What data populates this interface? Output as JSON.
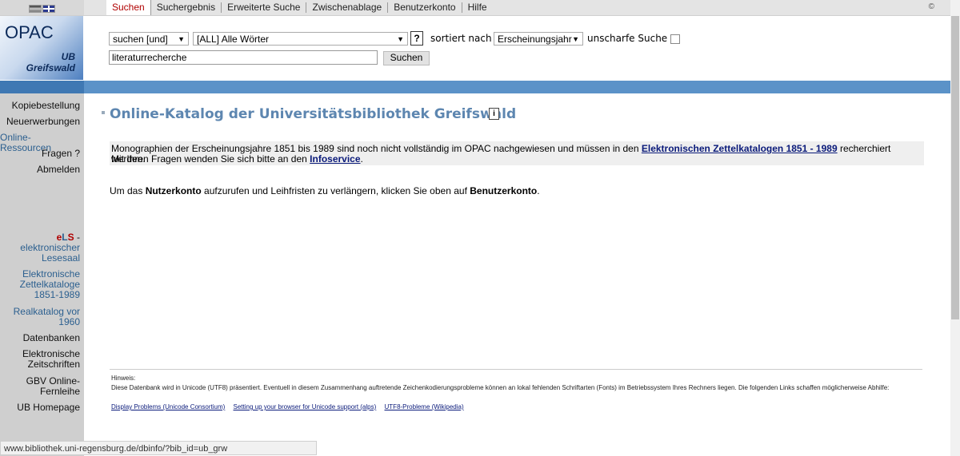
{
  "tabs": [
    {
      "label": "Suchen",
      "active": true
    },
    {
      "label": "Suchergebnis"
    },
    {
      "label": "Erweiterte Suche"
    },
    {
      "label": "Zwischenablage"
    },
    {
      "label": "Benutzerkonto"
    },
    {
      "label": "Hilfe"
    }
  ],
  "topbar": {
    "copyright_symbol": "©"
  },
  "logo": {
    "title": "OPAC",
    "line1": "UB",
    "line2": "Greifswald"
  },
  "search": {
    "mode_value": "suchen [und]",
    "field_value": "[ALL] Alle Wörter",
    "help_label": "?",
    "sort_label": "sortiert nach",
    "sort_value": "Erscheinungsjahr",
    "fuzzy_label": "unscharfe Suche",
    "query": "literaturrecherche",
    "submit_label": "Suchen"
  },
  "sidebar": {
    "items": [
      {
        "label": "Kopiebestellung"
      },
      {
        "label": "Neuerwerbungen"
      },
      {
        "label": "Online-Ressourcen"
      },
      {
        "label": "Fragen ?"
      },
      {
        "label": "Abmelden"
      }
    ],
    "els_e": "e",
    "els_l": "L",
    "els_s": "S",
    "els_dash": " -",
    "els_line2": "elektronischer",
    "els_line3": "Lesesaal",
    "zk_line1": "Elektronische",
    "zk_line2": "Zettelkataloge",
    "zk_line3": "1851-1989",
    "rk_line1": "Realkatalog vor",
    "rk_line2": "1960",
    "db": "Datenbanken",
    "ez_line1": "Elektronische",
    "ez_line2": "Zeitschriften",
    "gbv_line1": "GBV Online-",
    "gbv_line2": "Fernleihe",
    "homepage": "UB Homepage"
  },
  "main": {
    "title": "Online-Katalog der Universitätsbibliothek Greifswald",
    "info_icon": "i",
    "notice_l1_pre": "Monographien der Erscheinungsjahre 1851 bis 1989 sind noch nicht vollständig im OPAC nachgewiesen und müssen in den ",
    "notice_l1_link": "Elektronischen Zettelkatalogen 1851 - 1989",
    "notice_l1_post": " recherchiert werden.",
    "notice_l2_pre": "Mit Ihren Fragen wenden Sie sich bitte an den ",
    "notice_l2_link": "Infoservice",
    "notice_l2_post": ".",
    "account_pre": "Um das ",
    "account_bold1": "Nutzerkonto",
    "account_mid": " aufzurufen und Leihfristen zu verlängern, klicken Sie oben auf ",
    "account_bold2": "Benutzerkonto",
    "account_post": "."
  },
  "hint": {
    "label": "Hinweis:",
    "text": "Diese Datenbank wird in Unicode (UTF8) präsentiert. Eventuell in diesem Zusammenhang auftretende Zeichenkodierungsprobleme können an lokal fehlenden Schriftarten (Fonts) im Betriebssystem Ihres Rechners liegen. Die folgenden Links schaffen möglicherweise Abhilfe:",
    "links": [
      "Display Problems (Unicode Consortium)",
      "Setting up your browser for Unicode support (alps)",
      "UTF8-Probleme (Wikipedia)"
    ]
  },
  "status_url": "www.bibliothek.uni-regensburg.de/dbinfo/?bib_id=ub_grw"
}
